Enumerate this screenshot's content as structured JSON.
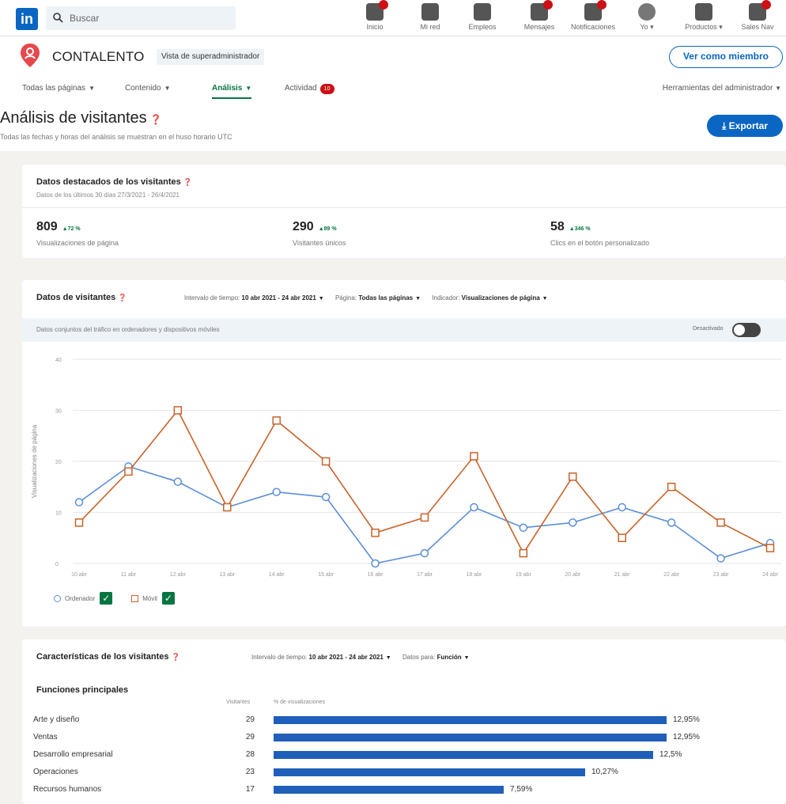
{
  "nav": {
    "logo": "in",
    "search_placeholder": "Buscar",
    "items": [
      {
        "label": "Inicio",
        "icon": "home-icon"
      },
      {
        "label": "Mi red",
        "icon": "network-icon"
      },
      {
        "label": "Empleos",
        "icon": "jobs-icon"
      },
      {
        "label": "Mensajes",
        "icon": "messaging-icon"
      },
      {
        "label": "Notificaciones",
        "icon": "bell-icon"
      },
      {
        "label": "Yo ▾",
        "icon": "avatar"
      },
      {
        "label": "Productos ▾",
        "icon": "grid-icon"
      },
      {
        "label": "Sales Nav",
        "icon": "sales-nav-icon"
      }
    ]
  },
  "page": {
    "company_name": "CONTALENTO",
    "admin_badge": "Vista de superadministrador",
    "view_as_member": "Ver como miembro",
    "tabs": [
      {
        "label": "Todas las páginas"
      },
      {
        "label": "Contenido"
      },
      {
        "label": "Análisis"
      },
      {
        "label": "Actividad",
        "count": "10"
      }
    ],
    "admin_tools": "Herramientas del administrador",
    "title": "Análisis de visitantes",
    "subtitle": "Todas las fechas y horas del análisis se muestran en el huso horario UTC",
    "export": "Exportar"
  },
  "highlights": {
    "title": "Datos destacados de los visitantes",
    "subtitle": "Datos de los últimos 30 días 27/3/2021 - 26/4/2021",
    "metrics": [
      {
        "value": "809",
        "delta": "▲72 %",
        "label": "Visualizaciones de página"
      },
      {
        "value": "290",
        "delta": "▲89 %",
        "label": "Visitantes únicos"
      },
      {
        "value": "58",
        "delta": "▲346 %",
        "label": "Clics en el botón personalizado"
      }
    ]
  },
  "visitors": {
    "title": "Datos de visitantes",
    "range_label": "Intervalo de tiempo:",
    "range_value": "10 abr 2021 - 24 abr 2021",
    "page_label": "Página:",
    "page_value": "Todas las páginas",
    "indicator_label": "Indicador:",
    "indicator_value": "Visualizaciones de página",
    "combined_text": "Datos conjuntos del tráfico en ordenadores y dispositivos móviles",
    "toggle_label": "Desactivado",
    "legend": {
      "desktop": "Ordenador",
      "mobile": "Móvil"
    }
  },
  "chart_data": {
    "type": "line",
    "ylabel": "Visualizaciones de página",
    "ylim": [
      0,
      40
    ],
    "yticks": [
      "0",
      "10",
      "20",
      "30",
      "40"
    ],
    "x": [
      "10 abr",
      "11 abr",
      "12 abr",
      "13 abr",
      "14 abr",
      "15 abr",
      "16 abr",
      "17 abr",
      "18 abr",
      "19 abr",
      "20 abr",
      "21 abr",
      "22 abr",
      "23 abr",
      "24 abr"
    ],
    "series": [
      {
        "name": "Ordenador",
        "color": "#5b8ed6",
        "values": [
          12,
          19,
          16,
          11,
          14,
          13,
          0,
          2,
          11,
          7,
          8,
          11,
          8,
          1,
          4
        ]
      },
      {
        "name": "Móvil",
        "color": "#c9622a",
        "values": [
          8,
          18,
          30,
          11,
          28,
          20,
          6,
          9,
          21,
          2,
          17,
          5,
          15,
          8,
          3
        ]
      }
    ],
    "grid": true,
    "legend_position": "bottom-left"
  },
  "characteristics": {
    "title": "Características de los visitantes",
    "range_label": "Intervalo de tiempo:",
    "range_value": "10 abr 2021 - 24 abr 2021",
    "data_label": "Datos para:",
    "data_value": "Función",
    "section_title": "Funciones principales",
    "col_visitors": "Visitantes",
    "col_pct": "% de visualizaciones",
    "rows": [
      {
        "name": "Arte y diseño",
        "visitors": "29",
        "pct_label": "12,95%",
        "pct": 12.95
      },
      {
        "name": "Ventas",
        "visitors": "29",
        "pct_label": "12,95%",
        "pct": 12.95
      },
      {
        "name": "Desarrollo empresarial",
        "visitors": "28",
        "pct_label": "12,5%",
        "pct": 12.5
      },
      {
        "name": "Operaciones",
        "visitors": "23",
        "pct_label": "10,27%",
        "pct": 10.27
      },
      {
        "name": "Recursos humanos",
        "visitors": "17",
        "pct_label": "7,59%",
        "pct": 7.59
      }
    ]
  }
}
